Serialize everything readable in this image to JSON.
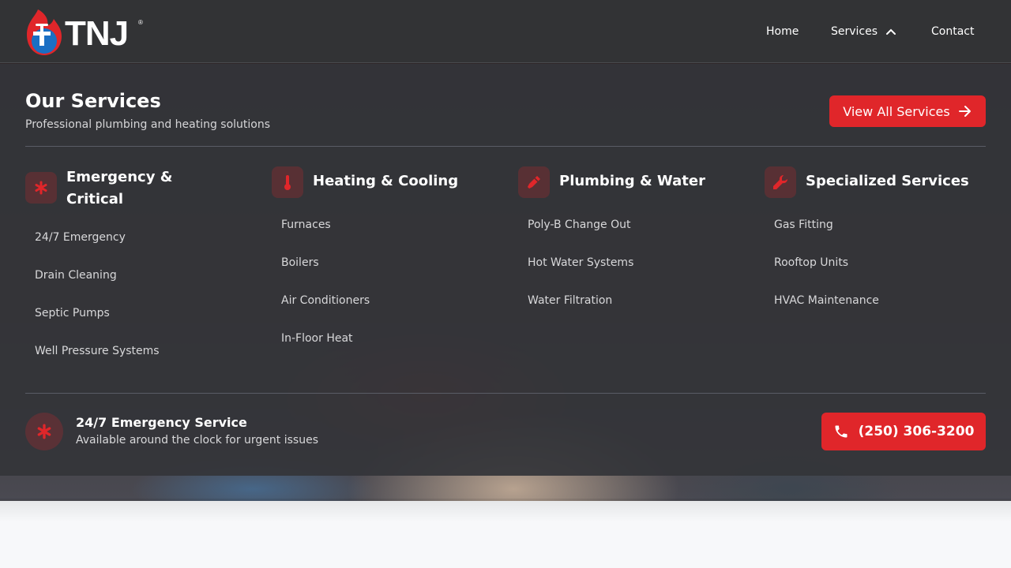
{
  "brand": {
    "name": "TNJ",
    "reg": "®"
  },
  "nav": {
    "home": "Home",
    "services": "Services",
    "contact": "Contact"
  },
  "panel": {
    "title": "Our Services",
    "subtitle": "Professional plumbing and heating solutions",
    "view_all": "View All Services",
    "columns": [
      {
        "title": "Emergency & Critical",
        "icon": "asterisk-icon",
        "items": [
          "24/7 Emergency",
          "Drain Cleaning",
          "Septic Pumps",
          "Well Pressure Systems"
        ]
      },
      {
        "title": "Heating & Cooling",
        "icon": "thermometer-icon",
        "items": [
          "Furnaces",
          "Boilers",
          "Air Conditioners",
          "In-Floor Heat"
        ]
      },
      {
        "title": "Plumbing & Water",
        "icon": "pipe-wrench-icon",
        "items": [
          "Poly-B Change Out",
          "Hot Water Systems",
          "Water Filtration"
        ]
      },
      {
        "title": "Specialized Services",
        "icon": "wrench-icon",
        "items": [
          "Gas Fitting",
          "Rooftop Units",
          "HVAC Maintenance"
        ]
      }
    ],
    "emergency": {
      "title": "24/7 Emergency Service",
      "subtitle": "Available around the clock for urgent issues",
      "phone": "(250) 306-3200"
    }
  },
  "colors": {
    "accent": "#e0262a",
    "panel": "#343539",
    "header": "#323335"
  }
}
